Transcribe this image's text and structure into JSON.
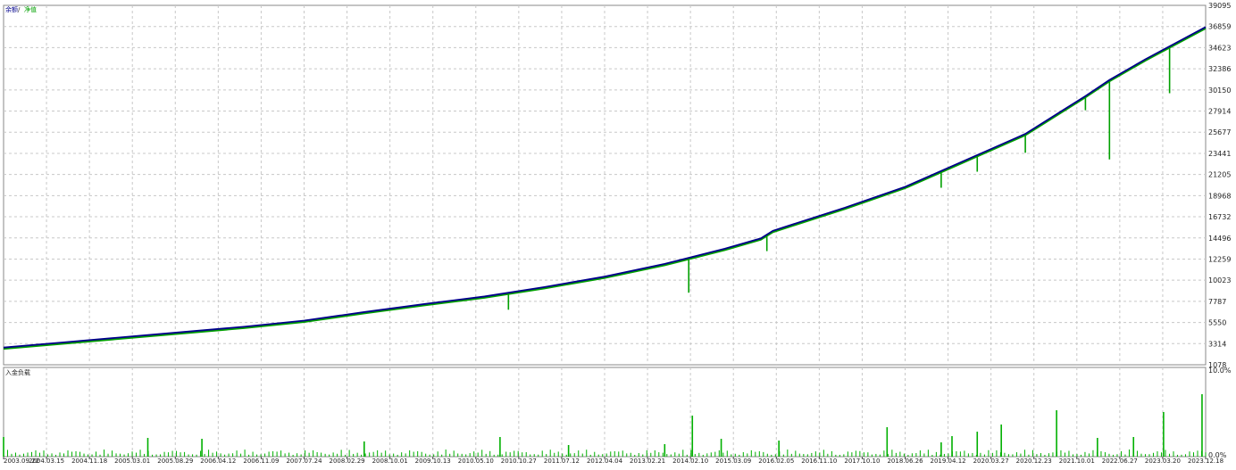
{
  "chart_data": {
    "type": "line",
    "top_panel": {
      "legend": [
        {
          "name": "余额",
          "color": "#00008B"
        },
        {
          "name": "净值",
          "color": "#00A000"
        }
      ],
      "legend_separator": " / ",
      "y_ticks": [
        39095,
        36859,
        34623,
        32386,
        30150,
        27914,
        25677,
        23441,
        21205,
        18968,
        16732,
        14496,
        12259,
        10023,
        7787,
        5550,
        3314,
        1078
      ],
      "ylim": [
        1078,
        39095
      ],
      "grid": true,
      "balance": {
        "x": [
          0,
          0.05,
          0.1,
          0.15,
          0.2,
          0.25,
          0.3,
          0.35,
          0.4,
          0.45,
          0.5,
          0.55,
          0.6,
          0.63,
          0.64,
          0.7,
          0.75,
          0.8,
          0.85,
          0.88,
          0.9,
          0.92,
          0.95,
          1.0
        ],
        "y": [
          2900,
          3450,
          4000,
          4550,
          5100,
          5750,
          6650,
          7500,
          8300,
          9300,
          10400,
          11750,
          13350,
          14450,
          15250,
          17700,
          19900,
          22700,
          25500,
          27900,
          29500,
          31200,
          33400,
          36800
        ]
      },
      "equity_drawdowns": [
        {
          "x": 0.57,
          "y": 8700
        },
        {
          "x": 0.42,
          "y": 6900
        },
        {
          "x": 0.635,
          "y": 13100
        },
        {
          "x": 0.78,
          "y": 19800
        },
        {
          "x": 0.81,
          "y": 21500
        },
        {
          "x": 0.92,
          "y": 22800
        },
        {
          "x": 0.97,
          "y": 29800
        },
        {
          "x": 0.9,
          "y": 28000
        },
        {
          "x": 0.85,
          "y": 23500
        }
      ]
    },
    "bottom_panel": {
      "title": "入金负载",
      "y_ticks": [
        "10.0%",
        "0.0%"
      ],
      "ylim": [
        0,
        10
      ],
      "color": "#00B000",
      "spikes": [
        {
          "x": 0.0,
          "y": 2.2
        },
        {
          "x": 0.165,
          "y": 2.0
        },
        {
          "x": 0.3,
          "y": 1.7
        },
        {
          "x": 0.413,
          "y": 2.2
        },
        {
          "x": 0.573,
          "y": 4.6
        },
        {
          "x": 0.597,
          "y": 2.0
        },
        {
          "x": 0.645,
          "y": 1.8
        },
        {
          "x": 0.735,
          "y": 3.3
        },
        {
          "x": 0.789,
          "y": 2.3
        },
        {
          "x": 0.83,
          "y": 3.6
        },
        {
          "x": 0.876,
          "y": 5.2
        },
        {
          "x": 0.91,
          "y": 2.1
        },
        {
          "x": 0.965,
          "y": 5.0
        },
        {
          "x": 0.997,
          "y": 7.0
        },
        {
          "x": 0.81,
          "y": 2.8
        },
        {
          "x": 0.55,
          "y": 1.4
        },
        {
          "x": 0.12,
          "y": 2.1
        },
        {
          "x": 0.94,
          "y": 2.2
        },
        {
          "x": 0.78,
          "y": 1.6
        },
        {
          "x": 0.47,
          "y": 1.3
        }
      ]
    },
    "x_tick_labels": [
      "2003.09.22",
      "2004.03.15",
      "2004.11.18",
      "2005.03.01",
      "2005.08.29",
      "2006.04.12",
      "2006.11.09",
      "2007.07.24",
      "2008.02.29",
      "2008.10.01",
      "2009.10.13",
      "2010.05.10",
      "2010.10.27",
      "2011.07.12",
      "2012.04.04",
      "2013.02.21",
      "2014.02.10",
      "2015.03.09",
      "2016.02.05",
      "2016.11.10",
      "2017.10.10",
      "2018.06.26",
      "2019.04.12",
      "2020.03.27",
      "2020.12.23",
      "2021.10.01",
      "2022.06.27",
      "2023.03.20",
      "2023.12.18"
    ]
  }
}
